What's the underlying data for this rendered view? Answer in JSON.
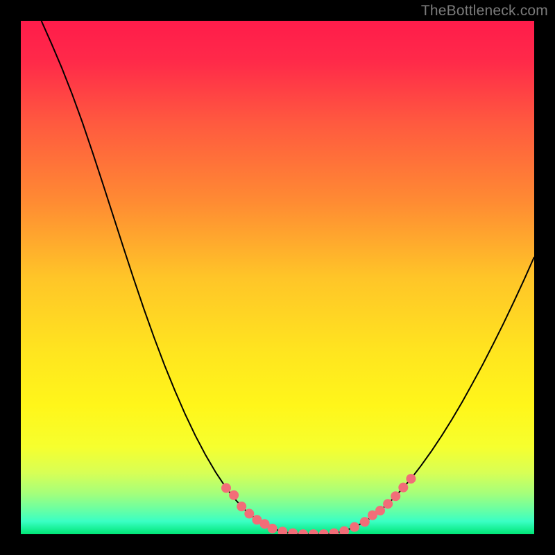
{
  "attribution": "TheBottleneck.com",
  "chart_data": {
    "type": "line",
    "title": "",
    "xlabel": "",
    "ylabel": "",
    "xlim": [
      0,
      100
    ],
    "ylim": [
      0,
      100
    ],
    "background_gradient": {
      "stops": [
        {
          "offset": 0.0,
          "color": "#ff1c4b"
        },
        {
          "offset": 0.08,
          "color": "#ff2a49"
        },
        {
          "offset": 0.2,
          "color": "#ff5a3f"
        },
        {
          "offset": 0.35,
          "color": "#ff8a33"
        },
        {
          "offset": 0.5,
          "color": "#ffc528"
        },
        {
          "offset": 0.65,
          "color": "#ffe61f"
        },
        {
          "offset": 0.75,
          "color": "#fff61a"
        },
        {
          "offset": 0.83,
          "color": "#f6ff2e"
        },
        {
          "offset": 0.88,
          "color": "#d8ff55"
        },
        {
          "offset": 0.92,
          "color": "#a6ff7a"
        },
        {
          "offset": 0.95,
          "color": "#6dffa0"
        },
        {
          "offset": 0.975,
          "color": "#3affc4"
        },
        {
          "offset": 1.0,
          "color": "#00e676"
        }
      ]
    },
    "series": [
      {
        "name": "bottleneck-curve",
        "stroke": "#000000",
        "stroke_width": 2,
        "points": [
          {
            "x": 4.0,
            "y": 100.0
          },
          {
            "x": 6.0,
            "y": 95.5
          },
          {
            "x": 8.0,
            "y": 90.8
          },
          {
            "x": 10.0,
            "y": 85.7
          },
          {
            "x": 12.0,
            "y": 80.2
          },
          {
            "x": 14.0,
            "y": 74.3
          },
          {
            "x": 16.0,
            "y": 68.2
          },
          {
            "x": 18.0,
            "y": 62.0
          },
          {
            "x": 20.0,
            "y": 55.8
          },
          {
            "x": 22.0,
            "y": 49.7
          },
          {
            "x": 24.0,
            "y": 43.8
          },
          {
            "x": 26.0,
            "y": 38.2
          },
          {
            "x": 28.0,
            "y": 32.9
          },
          {
            "x": 30.0,
            "y": 28.0
          },
          {
            "x": 32.0,
            "y": 23.4
          },
          {
            "x": 34.0,
            "y": 19.2
          },
          {
            "x": 36.0,
            "y": 15.4
          },
          {
            "x": 38.0,
            "y": 12.0
          },
          {
            "x": 40.0,
            "y": 9.0
          },
          {
            "x": 42.0,
            "y": 6.5
          },
          {
            "x": 44.0,
            "y": 4.4
          },
          {
            "x": 46.0,
            "y": 2.8
          },
          {
            "x": 48.0,
            "y": 1.6
          },
          {
            "x": 50.0,
            "y": 0.8
          },
          {
            "x": 52.0,
            "y": 0.3
          },
          {
            "x": 54.0,
            "y": 0.1
          },
          {
            "x": 56.0,
            "y": 0.0
          },
          {
            "x": 58.0,
            "y": 0.0
          },
          {
            "x": 60.0,
            "y": 0.1
          },
          {
            "x": 62.0,
            "y": 0.4
          },
          {
            "x": 64.0,
            "y": 1.0
          },
          {
            "x": 66.0,
            "y": 1.9
          },
          {
            "x": 68.0,
            "y": 3.1
          },
          {
            "x": 70.0,
            "y": 4.6
          },
          {
            "x": 72.0,
            "y": 6.4
          },
          {
            "x": 74.0,
            "y": 8.5
          },
          {
            "x": 76.0,
            "y": 10.8
          },
          {
            "x": 78.0,
            "y": 13.4
          },
          {
            "x": 80.0,
            "y": 16.2
          },
          {
            "x": 82.0,
            "y": 19.2
          },
          {
            "x": 84.0,
            "y": 22.4
          },
          {
            "x": 86.0,
            "y": 25.8
          },
          {
            "x": 88.0,
            "y": 29.4
          },
          {
            "x": 90.0,
            "y": 33.1
          },
          {
            "x": 92.0,
            "y": 37.0
          },
          {
            "x": 94.0,
            "y": 41.0
          },
          {
            "x": 96.0,
            "y": 45.2
          },
          {
            "x": 98.0,
            "y": 49.5
          },
          {
            "x": 100.0,
            "y": 54.0
          }
        ]
      }
    ],
    "markers": {
      "name": "highlight-dots",
      "fill": "#f26d78",
      "radius": 7,
      "points": [
        {
          "x": 40.0,
          "y": 9.0
        },
        {
          "x": 41.5,
          "y": 7.6
        },
        {
          "x": 43.0,
          "y": 5.4
        },
        {
          "x": 44.5,
          "y": 4.0
        },
        {
          "x": 46.0,
          "y": 2.8
        },
        {
          "x": 47.5,
          "y": 2.0
        },
        {
          "x": 49.0,
          "y": 1.1
        },
        {
          "x": 51.0,
          "y": 0.5
        },
        {
          "x": 53.0,
          "y": 0.2
        },
        {
          "x": 55.0,
          "y": 0.0
        },
        {
          "x": 57.0,
          "y": 0.0
        },
        {
          "x": 59.0,
          "y": 0.0
        },
        {
          "x": 61.0,
          "y": 0.2
        },
        {
          "x": 63.0,
          "y": 0.6
        },
        {
          "x": 65.0,
          "y": 1.4
        },
        {
          "x": 67.0,
          "y": 2.4
        },
        {
          "x": 68.5,
          "y": 3.7
        },
        {
          "x": 70.0,
          "y": 4.6
        },
        {
          "x": 71.5,
          "y": 5.9
        },
        {
          "x": 73.0,
          "y": 7.4
        },
        {
          "x": 74.5,
          "y": 9.1
        },
        {
          "x": 76.0,
          "y": 10.8
        }
      ]
    }
  }
}
